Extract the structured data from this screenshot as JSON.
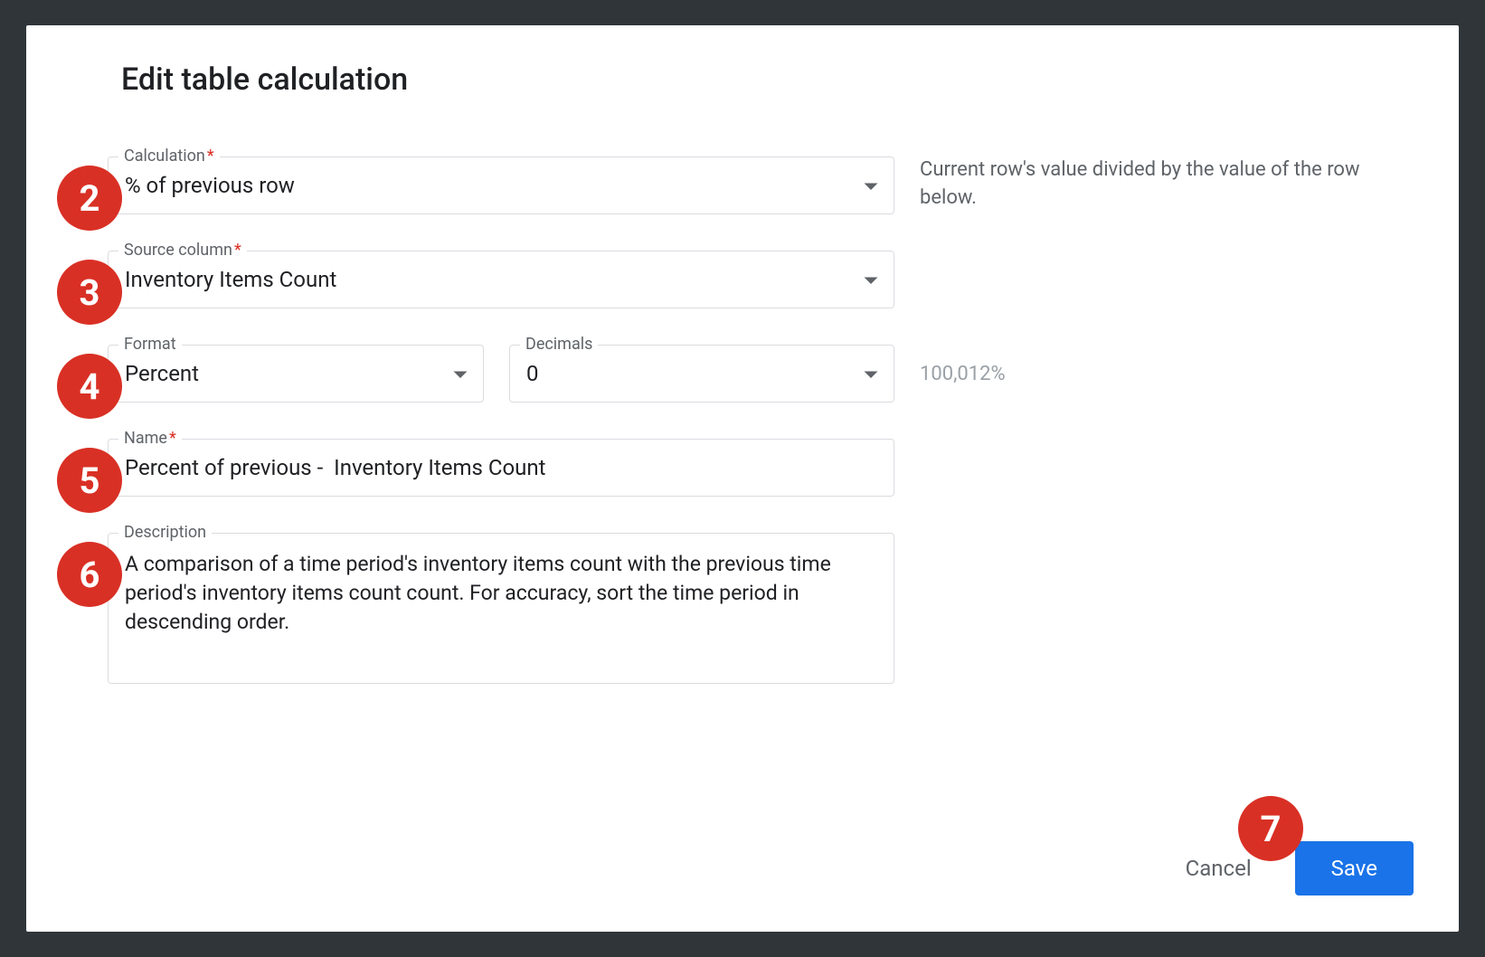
{
  "dialog": {
    "title": "Edit table calculation"
  },
  "badges": {
    "b2": "2",
    "b3": "3",
    "b4": "4",
    "b5": "5",
    "b6": "6",
    "b7": "7"
  },
  "fields": {
    "calculation": {
      "label": "Calculation",
      "required": "*",
      "value": "% of previous row",
      "helper": "Current row's value divided by the value of the row below."
    },
    "source_column": {
      "label": "Source column",
      "required": "*",
      "value": "Inventory Items Count"
    },
    "format": {
      "label": "Format",
      "value": "Percent"
    },
    "decimals": {
      "label": "Decimals",
      "value": "0"
    },
    "format_preview": "100,012%",
    "name": {
      "label": "Name",
      "required": "*",
      "value": "Percent of previous -  Inventory Items Count"
    },
    "description": {
      "label": "Description",
      "value": "A comparison of a time period's inventory items count with the previous time period's inventory items count count. For accuracy, sort the time period in descending order."
    }
  },
  "actions": {
    "cancel": "Cancel",
    "save": "Save"
  }
}
